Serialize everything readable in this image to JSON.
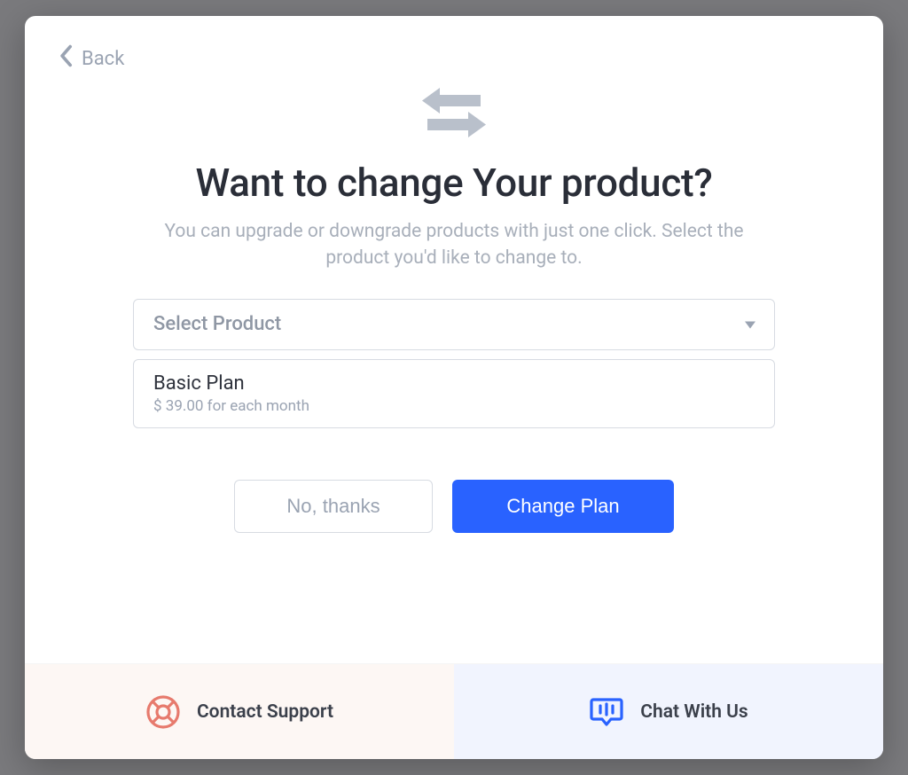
{
  "nav": {
    "back_label": "Back"
  },
  "hero": {
    "title": "Want to change Your product?",
    "subtitle": "You can upgrade or downgrade products with just one click. Select the product you'd like to change to."
  },
  "select": {
    "placeholder": "Select Product",
    "options": [
      {
        "name": "Basic Plan",
        "price": "$ 39.00 for each month"
      }
    ]
  },
  "buttons": {
    "decline": "No, thanks",
    "confirm": "Change Plan"
  },
  "footer": {
    "support_label": "Contact Support",
    "chat_label": "Chat With Us"
  },
  "colors": {
    "primary": "#2962ff",
    "muted": "#9aa3b2",
    "support_accent": "#e77a6d",
    "chat_accent": "#2962ff"
  }
}
